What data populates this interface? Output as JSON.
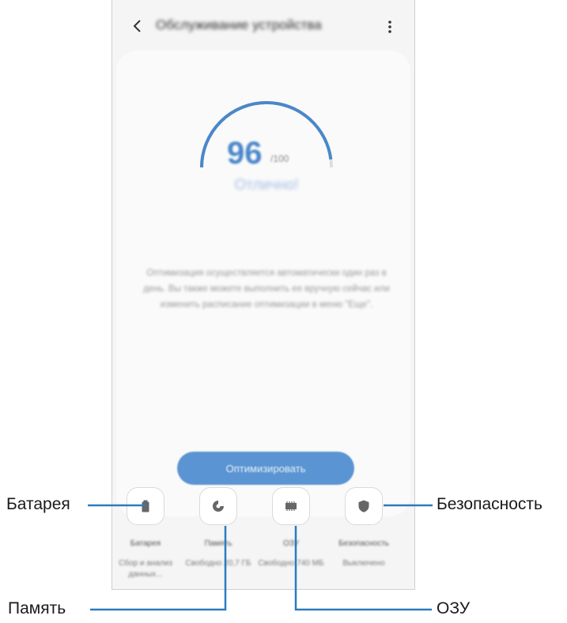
{
  "header": {
    "title": "Обслуживание устройства"
  },
  "score": {
    "value": "96",
    "max": "/100",
    "fraction": 0.96,
    "status": "Отлично!"
  },
  "description": "Оптимизация осуществляется автоматически один раз в день. Вы также можете выполнить ее вручную сейчас или изменить расписание оптимизации в меню \"Еще\".",
  "optimize_button": "Оптимизировать",
  "tiles": [
    {
      "title": "Батарея",
      "subtitle": "Сбор и анализ данных..."
    },
    {
      "title": "Память",
      "subtitle": "Свободно 20,7 ГБ"
    },
    {
      "title": "ОЗУ",
      "subtitle": "Свободно 740 МБ"
    },
    {
      "title": "Безопасность",
      "subtitle": "Выключено"
    }
  ],
  "callouts": {
    "battery": "Батарея",
    "memory": "Память",
    "ram": "ОЗУ",
    "security": "Безопасность"
  },
  "colors": {
    "accent": "#4a87c9",
    "button": "#5b94d2",
    "callout_line": "#2b7bbf"
  }
}
